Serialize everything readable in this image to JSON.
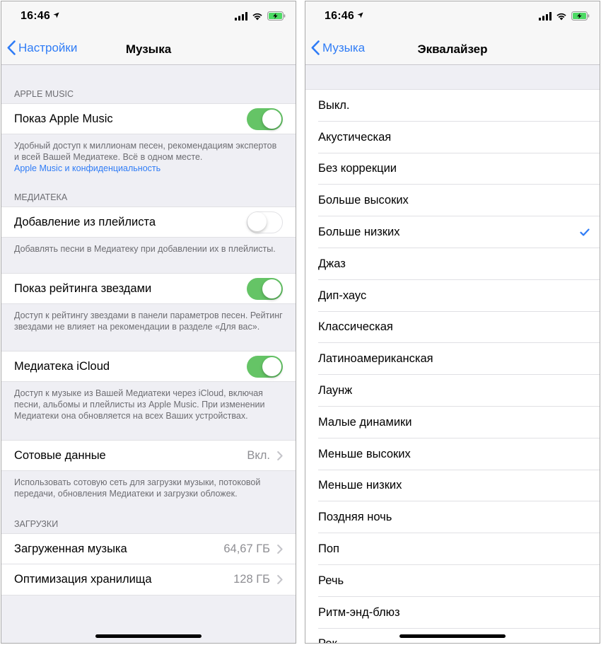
{
  "left": {
    "status": {
      "time": "16:46"
    },
    "nav": {
      "back_label": "Настройки",
      "title": "Музыка"
    },
    "apple_music": {
      "header": "APPLE MUSIC",
      "show_label": "Показ Apple Music",
      "show_on": true,
      "footer": "Удобный доступ к миллионам песен, рекомендациям экспертов и всей Вашей Медиатеке. Всё в одном месте.",
      "footer_link": "Apple Music и конфиденциальность"
    },
    "library": {
      "header": "МЕДИАТЕКА",
      "add_playlist_label": "Добавление из плейлиста",
      "add_playlist_on": false,
      "add_playlist_footer": "Добавлять песни в Медиатеку при добавлении их в плейлисты.",
      "star_rating_label": "Показ рейтинга звездами",
      "star_rating_on": true,
      "star_rating_footer": "Доступ к рейтингу звездами в панели параметров песен. Рейтинг звездами не влияет на рекомендации в разделе «Для вас».",
      "icloud_label": "Медиатека iCloud",
      "icloud_on": true,
      "icloud_footer": "Доступ к музыке из Вашей Медиатеки через iCloud, включая песни, альбомы и плейлисты из Apple Music. При изменении Медиатеки она обновляется на всех Ваших устройствах."
    },
    "cellular": {
      "label": "Сотовые данные",
      "value": "Вкл.",
      "footer": "Использовать сотовую сеть для загрузки музыки, потоковой передачи, обновления Медиатеки и загрузки обложек."
    },
    "downloads": {
      "header": "ЗАГРУЗКИ",
      "downloaded_label": "Загруженная музыка",
      "downloaded_value": "64,67 ГБ",
      "optimize_label": "Оптимизация хранилища",
      "optimize_value": "128 ГБ"
    }
  },
  "right": {
    "status": {
      "time": "16:46"
    },
    "nav": {
      "back_label": "Музыка",
      "title": "Эквалайзер"
    },
    "eq_items": [
      "Выкл.",
      "Акустическая",
      "Без коррекции",
      "Больше высоких",
      "Больше низких",
      "Джаз",
      "Дип-хаус",
      "Классическая",
      "Латиноамериканская",
      "Лаунж",
      "Малые динамики",
      "Меньше высоких",
      "Меньше низких",
      "Поздняя ночь",
      "Поп",
      "Речь",
      "Ритм-энд-блюз",
      "Рок"
    ],
    "selected": "Больше низких"
  },
  "colors": {
    "accent": "#2f7cf6",
    "toggle_on": "#65c466",
    "background": "#efeff4"
  }
}
